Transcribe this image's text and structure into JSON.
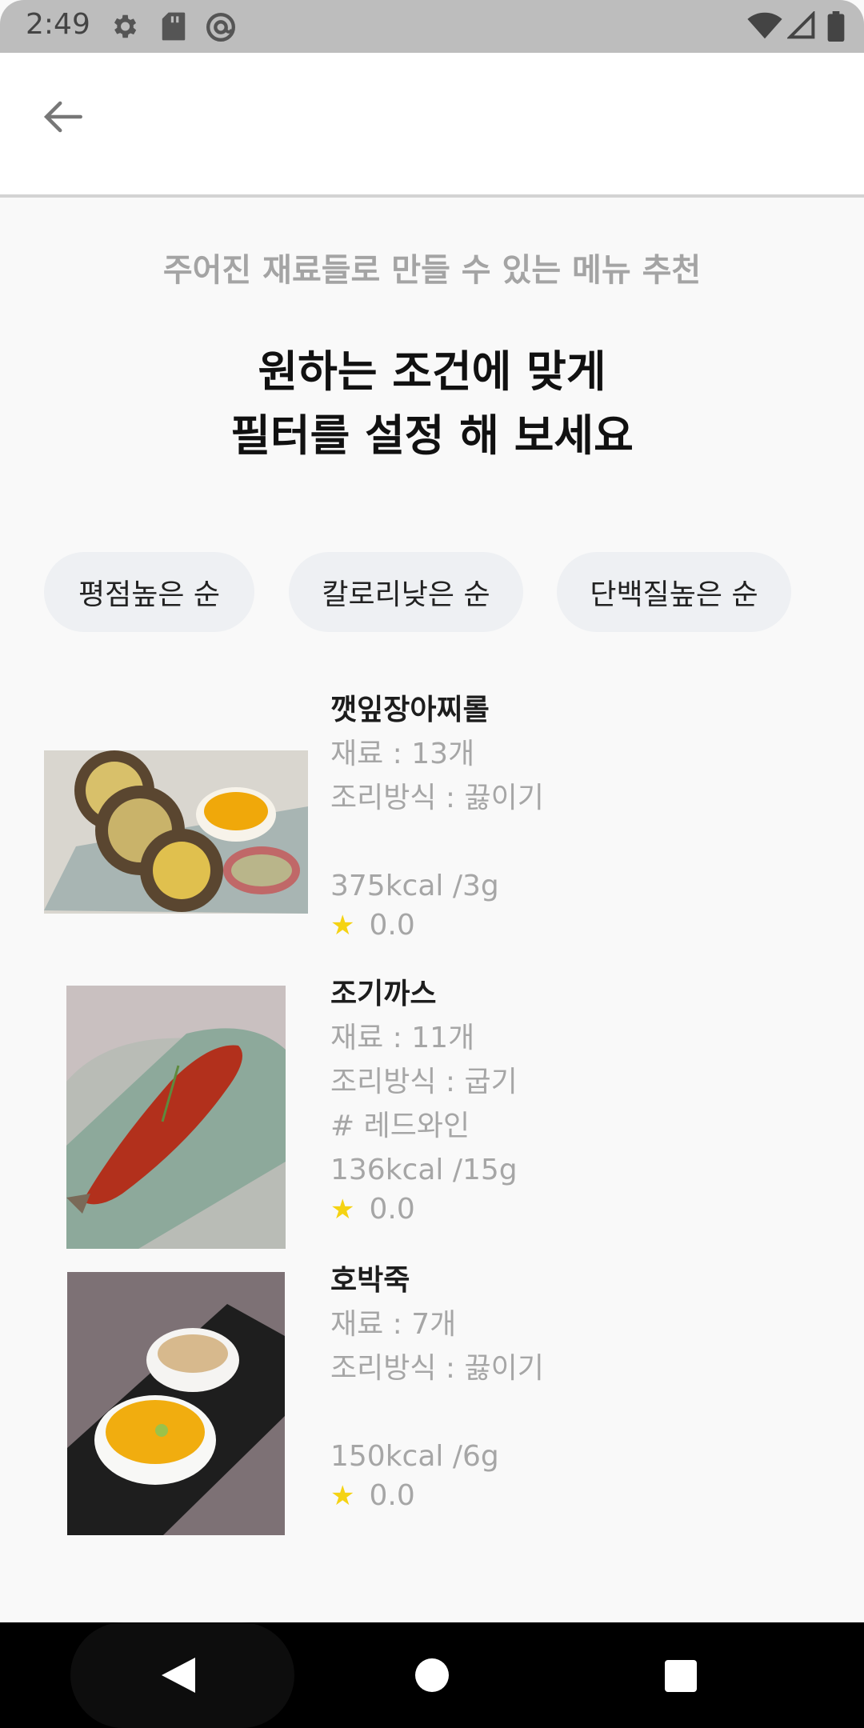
{
  "status_bar": {
    "time": "2:49",
    "icons": [
      "gear-icon",
      "sd-card-icon",
      "at-sign-icon",
      "wifi-icon",
      "signal-icon",
      "battery-icon"
    ]
  },
  "app_bar": {
    "back_icon": "arrow-left-icon"
  },
  "header": {
    "subtitle": "주어진 재료들로 만들 수 있는 메뉴 추천",
    "headline_line1": "원하는 조건에 맞게",
    "headline_line2": "필터를 설정 해 보세요"
  },
  "filters": [
    {
      "label": "평점높은 순"
    },
    {
      "label": "칼로리낮은 순"
    },
    {
      "label": "단백질높은 순"
    }
  ],
  "recipes": [
    {
      "name": "깻잎장아찌롤",
      "ingredients": "재료 : 13개",
      "method": "조리방식 : 끓이기",
      "tag": "",
      "nutrition": "375kcal /3g",
      "rating": "0.0"
    },
    {
      "name": "조기까스",
      "ingredients": "재료 : 11개",
      "method": "조리방식 : 굽기",
      "tag": "# 레드와인",
      "nutrition": "136kcal /15g",
      "rating": "0.0"
    },
    {
      "name": "호박죽",
      "ingredients": "재료 : 7개",
      "method": "조리방식 : 끓이기",
      "tag": "",
      "nutrition": "150kcal /6g",
      "rating": "0.0"
    }
  ],
  "nav": {
    "back": "back-triangle-icon",
    "home": "home-circle-icon",
    "recents": "recents-square-icon"
  },
  "colors": {
    "star": "#f5d313",
    "chip_bg": "#eef0f3",
    "muted_text": "#a6a6a6"
  }
}
